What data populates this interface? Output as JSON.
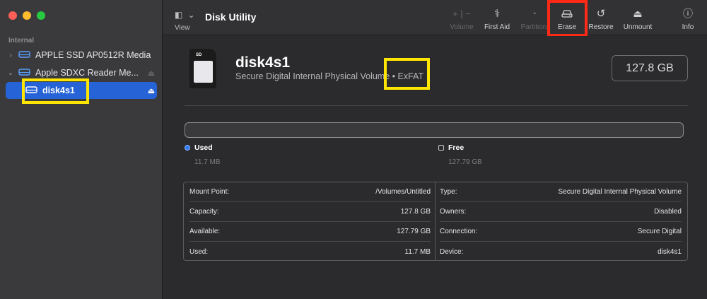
{
  "app": {
    "title": "Disk Utility"
  },
  "toolbar": {
    "view_label": "View",
    "view_icons": "◧ ⌄",
    "tools": [
      {
        "label": "Volume",
        "icon": "plus-minus-icon",
        "glyph": "+ | −",
        "enabled": false
      },
      {
        "label": "First Aid",
        "icon": "stethoscope-icon",
        "glyph": "⚕",
        "enabled": true
      },
      {
        "label": "Partition",
        "icon": "partition-icon",
        "glyph": "◔",
        "enabled": false
      },
      {
        "label": "Erase",
        "icon": "erase-drive-icon",
        "glyph": "⛟",
        "enabled": true
      },
      {
        "label": "Restore",
        "icon": "restore-icon",
        "glyph": "↺",
        "enabled": true
      },
      {
        "label": "Unmount",
        "icon": "unmount-icon",
        "glyph": "⏏",
        "enabled": true
      },
      {
        "label": "Info",
        "icon": "info-icon",
        "glyph": "ⓘ",
        "enabled": true
      }
    ]
  },
  "sidebar": {
    "section": "Internal",
    "items": [
      {
        "label": "APPLE SSD AP0512R Media",
        "chevron": "›",
        "selected": false
      },
      {
        "label": "Apple SDXC Reader Me...",
        "chevron": "⌄",
        "selected": false,
        "eject": "⏏"
      },
      {
        "label": "disk4s1",
        "chevron": "",
        "selected": true,
        "eject": "⏏"
      }
    ]
  },
  "volume": {
    "name": "disk4s1",
    "description": "Secure Digital Internal Physical Volume",
    "separator": " • ",
    "format": "ExFAT",
    "capacity": "127.8 GB",
    "icon_text": "SD"
  },
  "usage": {
    "used_fraction": 0.0001,
    "used_label": "Used",
    "used_value": "11.7 MB",
    "free_label": "Free",
    "free_value": "127.79 GB"
  },
  "info": {
    "left": [
      {
        "key": "Mount Point:",
        "value": "/Volumes/Untitled"
      },
      {
        "key": "Capacity:",
        "value": "127.8 GB"
      },
      {
        "key": "Available:",
        "value": "127.79 GB"
      },
      {
        "key": "Used:",
        "value": "11.7 MB"
      }
    ],
    "right": [
      {
        "key": "Type:",
        "value": "Secure Digital Internal Physical Volume"
      },
      {
        "key": "Owners:",
        "value": "Disabled"
      },
      {
        "key": "Connection:",
        "value": "Secure Digital"
      },
      {
        "key": "Device:",
        "value": "disk4s1"
      }
    ]
  },
  "colors": {
    "accent": "#2563d6",
    "highlight_red": "#ff2a16",
    "highlight_yellow": "#ffe600"
  }
}
